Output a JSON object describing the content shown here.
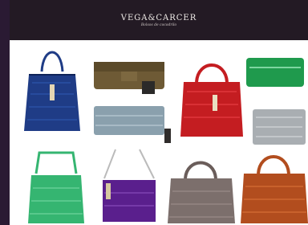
{
  "header": {
    "logo": "VEGA&CARCER",
    "tagline": "Bolsos de cocodrilo"
  },
  "products": [
    {
      "name": "Navy croc bucket bag",
      "color": "#1f3c86"
    },
    {
      "name": "Olive suede clutch",
      "color": "#6e5a35"
    },
    {
      "name": "Red croc handbag",
      "color": "#c41d21"
    },
    {
      "name": "Green croc wallet",
      "color": "#1f9a4d"
    },
    {
      "name": "Grey croc clutch",
      "color": "#8aa0ad"
    },
    {
      "name": "Grey croc wallet",
      "color": "#a9aeb2"
    },
    {
      "name": "Green croc shoulder bag",
      "color": "#35b571"
    },
    {
      "name": "Purple croc crossbody",
      "color": "#5a1f8d"
    },
    {
      "name": "Taupe croc doctor bag",
      "color": "#7c6f6c"
    },
    {
      "name": "Cognac croc handbag",
      "color": "#b24d1e"
    }
  ]
}
